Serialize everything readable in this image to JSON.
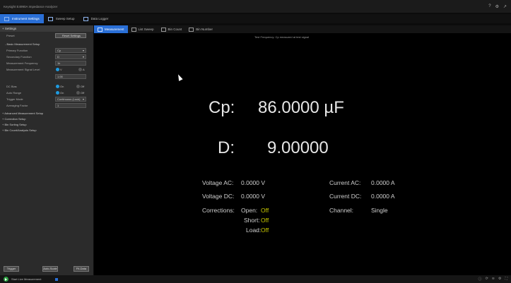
{
  "titlebar": {
    "title": "Keysight E4990A Impedance Analyzer",
    "icons": [
      "help-icon",
      "settings-icon",
      "external-link-icon"
    ]
  },
  "main_tabs": [
    {
      "label": "Instrument Settings",
      "icon": "instrument-icon",
      "active": true
    },
    {
      "label": "Sweep Setup",
      "icon": "chart-icon",
      "active": false
    },
    {
      "label": "Data Logger",
      "icon": "logger-icon",
      "active": false
    }
  ],
  "sidebar": {
    "header": "+ Settings",
    "preset_label": "Preset",
    "preset_button": "Reset Settings",
    "basic_section": "- Basic Measurement Setup",
    "primary_label": "Primary Function",
    "primary_value": "Cp",
    "secondary_label": "Secondary Function",
    "secondary_value": "D",
    "freq_label": "Measurement Frequency",
    "freq_value": "1k",
    "osc_label": "Measurement Signal Level",
    "osc_opt1": "V",
    "osc_opt2": "A",
    "osc_value": "1.00",
    "dc_bias_label": "DC Bias",
    "dc_bias_on": "On",
    "dc_bias_off": "Off",
    "auto_range_label": "Auto Range",
    "auto_range_on": "On",
    "auto_range_off": "Off",
    "trigger_label": "Trigger Mode",
    "trigger_value": "Continuous (Lock)",
    "averaging_label": "Averaging Factor",
    "averaging_value": "1",
    "sections": [
      "+ Advanced Measurement Setup",
      "+ Correction Setup",
      "+ Bin Sorting Setup",
      "+ Bin Count/Analysis Setup"
    ],
    "bottom_buttons": [
      "Trigger",
      "Auto-Scale",
      "Fit-Data"
    ]
  },
  "sub_tabs": [
    {
      "label": "Measurement",
      "icon": "monitor-icon",
      "active": true
    },
    {
      "label": "List Sweep",
      "icon": "list-icon",
      "active": false
    },
    {
      "label": "Bin Count",
      "icon": "bar-chart-icon",
      "active": false
    },
    {
      "label": "Bin Number",
      "icon": "number-icon",
      "active": false
    }
  ],
  "display": {
    "test_freq": "Test Frequency:  Cp measured at test signal",
    "primary_label": "Cp:",
    "primary_value": "86.0000 µF",
    "secondary_label": "D:",
    "secondary_value": "9.00000",
    "voltage_ac_label": "Voltage AC:",
    "voltage_ac_value": "0.0000  V",
    "current_ac_label": "Current AC:",
    "current_ac_value": "0.0000  A",
    "voltage_dc_label": "Voltage DC:",
    "voltage_dc_value": "0.0000  V",
    "current_dc_label": "Current DC:",
    "current_dc_value": "0.0000  A",
    "corrections_label": "Corrections:",
    "open_label": "Open:",
    "open_value": "Off",
    "short_label": "Short:",
    "short_value": "Off",
    "load_label": "Load:",
    "load_value": "Off",
    "channel_label": "Channel:",
    "channel_value": "Single"
  },
  "statusbar": {
    "label": "Start Live Measurement",
    "right_icons": [
      "info-icon",
      "sync-icon",
      "wifi-icon",
      "settings-icon",
      "fullscreen-icon"
    ]
  },
  "colors": {
    "accent": "#2a6fd6",
    "corrections_value": "#c8c800",
    "status_ok": "#2ea043"
  }
}
